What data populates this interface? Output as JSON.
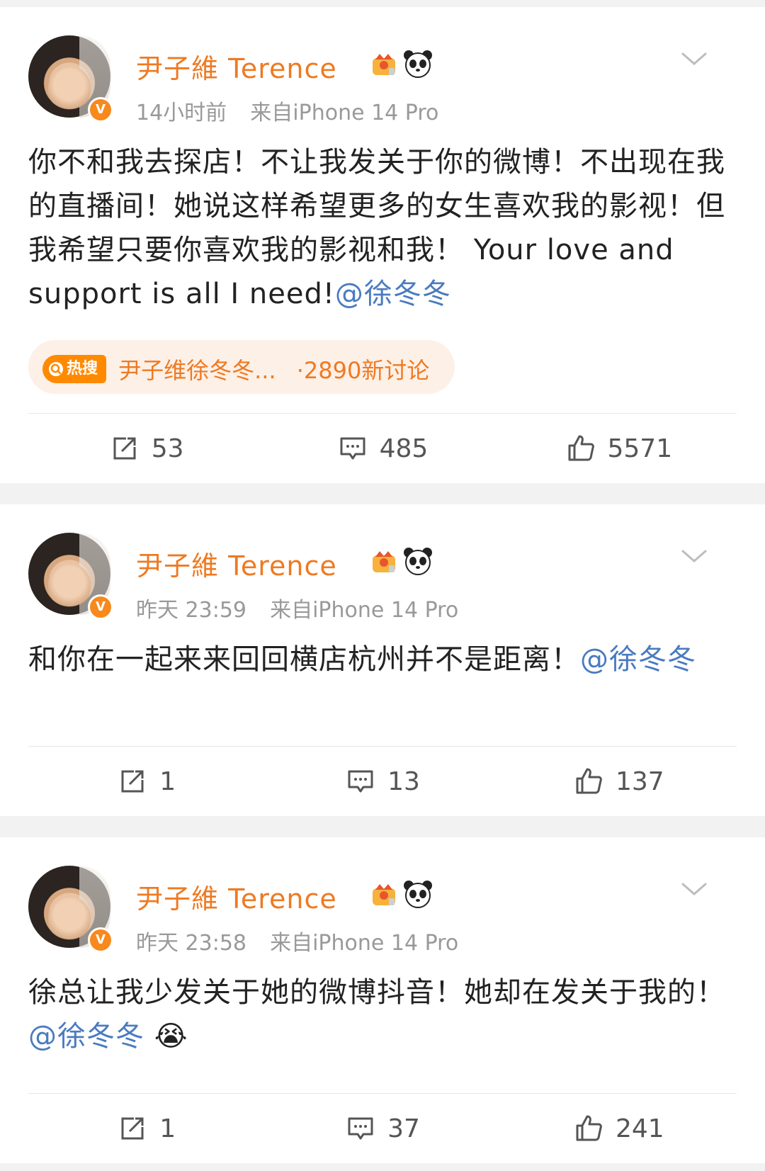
{
  "posts": [
    {
      "user_name": "尹子維 Terence",
      "time": "14小时前",
      "source": "来自iPhone 14 Pro",
      "text": "你不和我去探店！不让我发关于你的微博！不出现在我的直播间！她说这样希望更多的女生喜欢我的影视！但我希望只要你喜欢我的影视和我！ Your love and support is all I need!",
      "mention": "@徐冬冬",
      "emoji": "",
      "hot_search": {
        "tag": "热搜",
        "title": "尹子维徐冬冬...",
        "count": "·2890新讨论"
      },
      "reposts": "53",
      "comments": "485",
      "likes": "5571"
    },
    {
      "user_name": "尹子維 Terence",
      "time": "昨天 23:59",
      "source": "来自iPhone 14 Pro",
      "text": "和你在一起来来回回横店杭州并不是距离！",
      "mention": "@徐冬冬",
      "emoji": "",
      "reposts": "1",
      "comments": "13",
      "likes": "137"
    },
    {
      "user_name": "尹子維 Terence",
      "time": "昨天 23:58",
      "source": "来自iPhone 14 Pro",
      "text": "徐总让我少发关于她的微博抖音！她却在发关于我的！",
      "mention": "@徐冬冬",
      "emoji": "😭",
      "reposts": "1",
      "comments": "37",
      "likes": "241"
    }
  ],
  "icons": {
    "verify": "V",
    "crown": "crown-badge-icon",
    "panda": "panda-icon",
    "more": "chevron-down-icon",
    "repost": "repost-icon",
    "comment": "comment-icon",
    "like": "thumbs-up-icon"
  },
  "colors": {
    "name": "#ee7a22",
    "mention": "#4a7bbf",
    "meta": "#999999",
    "hot_tag": "#ff8a00",
    "hot_bg": "#fdf0e6"
  }
}
